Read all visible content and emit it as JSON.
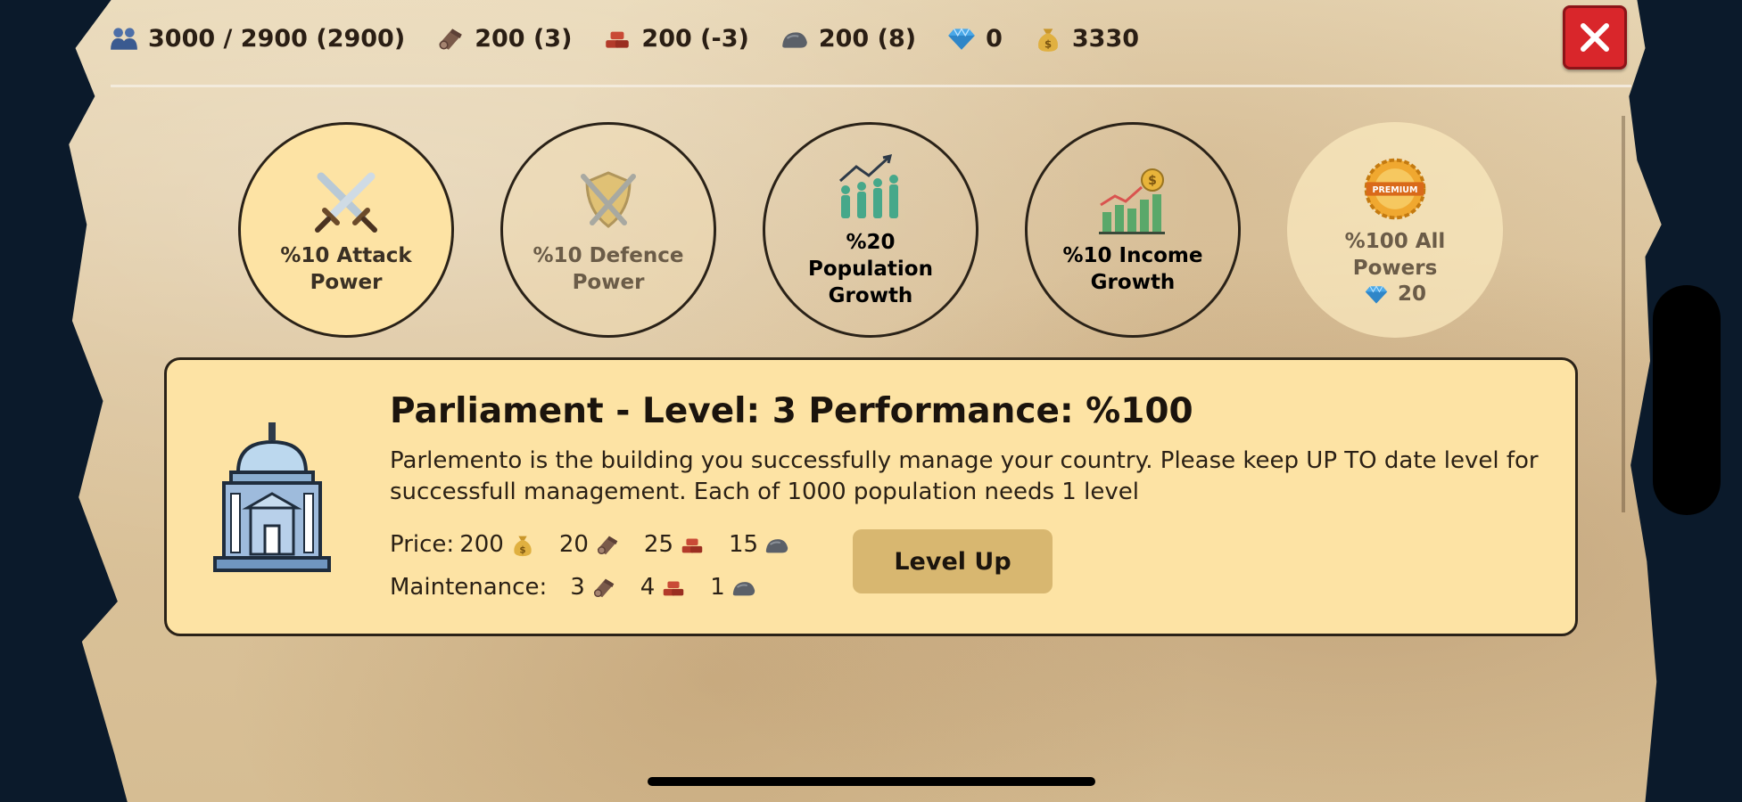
{
  "resources": {
    "population": {
      "icon": "population-icon",
      "value": "3000 / 2900 (2900)"
    },
    "wood": {
      "icon": "wood-icon",
      "value": "200 (3)"
    },
    "clay": {
      "icon": "clay-icon",
      "value": "200 (-3)"
    },
    "stone": {
      "icon": "stone-icon",
      "value": "200 (8)"
    },
    "gems": {
      "icon": "gem-icon",
      "value": "0"
    },
    "gold": {
      "icon": "gold-bag-icon",
      "value": "3330"
    }
  },
  "close_icon": "close-icon",
  "powers": [
    {
      "label": "%10 Attack Power",
      "icon": "crossed-swords-icon",
      "state": "selected"
    },
    {
      "label": "%10 Defence Power",
      "icon": "shield-swords-icon",
      "state": "dim"
    },
    {
      "label": "%20 Population Growth",
      "icon": "population-growth-icon",
      "state": "normal"
    },
    {
      "label": "%10 Income Growth",
      "icon": "income-chart-icon",
      "state": "normal"
    },
    {
      "label": "%100 All Powers",
      "icon": "premium-badge-icon",
      "badge_text": "PREMIUM",
      "cost": "20",
      "state": "premium"
    }
  ],
  "building": {
    "icon": "parliament-building-icon",
    "title": "Parliament - Level: 3 Performance: %100",
    "description": "Parlemento is the building you successfully manage your country. Please keep UP TO date level for successfull management. Each of 1000 population needs 1 level",
    "price_label": "Price:",
    "price": {
      "gold": "200",
      "wood": "20",
      "clay": "25",
      "stone": "15"
    },
    "maintenance_label": "Maintenance:",
    "maintenance": {
      "wood": "3",
      "clay": "4",
      "stone": "1"
    },
    "level_up_label": "Level Up"
  },
  "colors": {
    "panel_bg": "#fde3a4",
    "close_button": "#d9262b",
    "level_up_button": "#d8b770",
    "page_bg": "#0b1a2b"
  }
}
